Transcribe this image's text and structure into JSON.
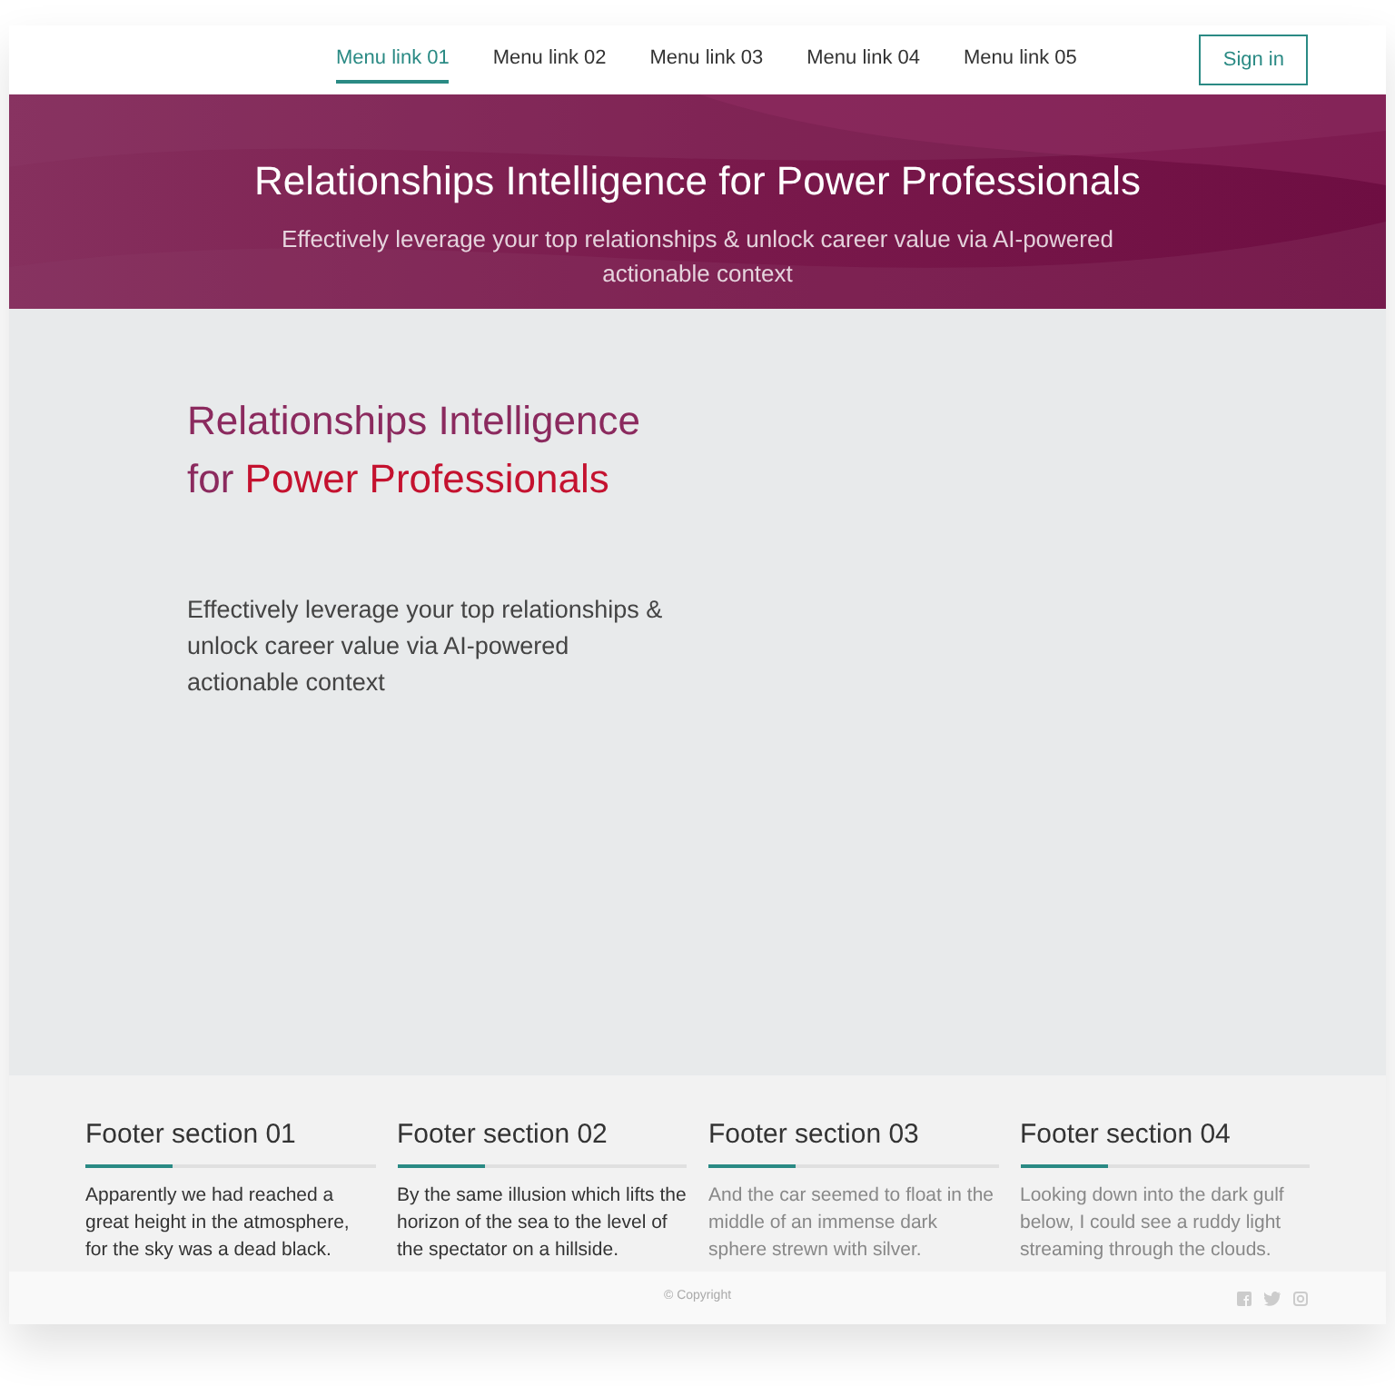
{
  "nav": {
    "links": [
      {
        "label": "Menu link 01",
        "selected": true
      },
      {
        "label": "Menu link 02",
        "selected": false
      },
      {
        "label": "Menu link 03",
        "selected": false
      },
      {
        "label": "Menu link 04",
        "selected": false
      },
      {
        "label": "Menu link 05",
        "selected": false
      }
    ],
    "sign_in": "Sign in"
  },
  "hero": {
    "title": "Relationships Intelligence for Power Professionals",
    "subtitle": "Effectively leverage your top relationships & unlock career value via AI-powered actionable context"
  },
  "main": {
    "title_lines": [
      [
        {
          "text": "Relationships Intelligence",
          "color": "#8b2a5e"
        }
      ],
      [
        {
          "text": "for",
          "color": "#8b2a5e"
        },
        {
          "text": "Power Professionals",
          "color": "#c4122f"
        }
      ]
    ],
    "lead": "Effectively leverage your top relationships & unlock career value via AI-powered actionable context"
  },
  "footer": {
    "sections": [
      {
        "title": "Footer section 01",
        "text": "Apparently we had reached a great height in the atmosphere, for the sky was a dead black.",
        "muted": false
      },
      {
        "title": "Footer section 02",
        "text": "By the same illusion which lifts the horizon of the sea to the level of the spectator on a hillside.",
        "muted": false
      },
      {
        "title": "Footer section 03",
        "text": "And the car seemed to float in the middle of an immense dark sphere strewn with silver.",
        "muted": true
      },
      {
        "title": "Footer section 04",
        "text": "Looking down into the dark gulf below, I could see a ruddy light streaming through the clouds.",
        "muted": true
      }
    ],
    "copyright": "© Copyright"
  }
}
